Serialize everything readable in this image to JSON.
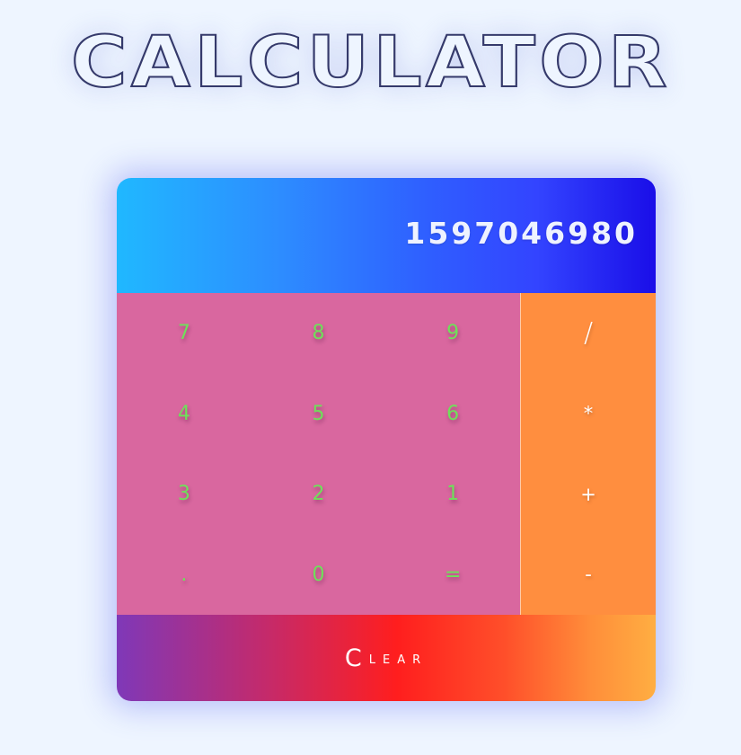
{
  "page": {
    "title": "CALCULATOR"
  },
  "display": {
    "value": "1597046980"
  },
  "keypad": {
    "keys": [
      {
        "label": "7",
        "name": "key-7"
      },
      {
        "label": "8",
        "name": "key-8"
      },
      {
        "label": "9",
        "name": "key-9"
      },
      {
        "label": "4",
        "name": "key-4"
      },
      {
        "label": "5",
        "name": "key-5"
      },
      {
        "label": "6",
        "name": "key-6"
      },
      {
        "label": "3",
        "name": "key-3"
      },
      {
        "label": "2",
        "name": "key-2"
      },
      {
        "label": "1",
        "name": "key-1"
      },
      {
        "label": ".",
        "name": "key-decimal"
      },
      {
        "label": "0",
        "name": "key-0"
      },
      {
        "label": "=",
        "name": "key-equals"
      }
    ]
  },
  "operators": {
    "keys": [
      {
        "label": "/",
        "name": "key-divide"
      },
      {
        "label": "*",
        "name": "key-multiply"
      },
      {
        "label": "+",
        "name": "key-add"
      },
      {
        "label": "-",
        "name": "key-subtract"
      }
    ]
  },
  "clear": {
    "first": "C",
    "rest": "LEAR"
  },
  "colors": {
    "background": "#eef5ff",
    "display_start": "#20b8ff",
    "display_end": "#1a0ee8",
    "keypad": "#d9679f",
    "operators": "#ff8e3f",
    "digit_text": "#6fe05a",
    "title_stroke": "#353a6b"
  }
}
